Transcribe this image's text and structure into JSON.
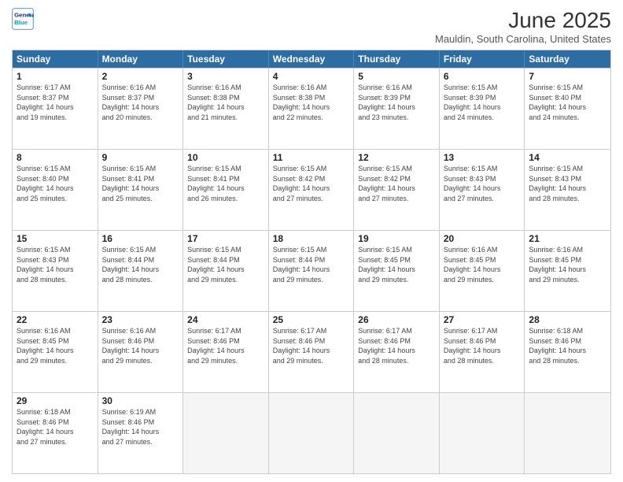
{
  "header": {
    "logo_line1": "General",
    "logo_line2": "Blue",
    "month_title": "June 2025",
    "location": "Mauldin, South Carolina, United States"
  },
  "days_of_week": [
    "Sunday",
    "Monday",
    "Tuesday",
    "Wednesday",
    "Thursday",
    "Friday",
    "Saturday"
  ],
  "weeks": [
    [
      {
        "num": "1",
        "sunrise": "6:17 AM",
        "sunset": "8:37 PM",
        "daylight": "14 hours and 19 minutes"
      },
      {
        "num": "2",
        "sunrise": "6:16 AM",
        "sunset": "8:37 PM",
        "daylight": "14 hours and 20 minutes"
      },
      {
        "num": "3",
        "sunrise": "6:16 AM",
        "sunset": "8:38 PM",
        "daylight": "14 hours and 21 minutes"
      },
      {
        "num": "4",
        "sunrise": "6:16 AM",
        "sunset": "8:38 PM",
        "daylight": "14 hours and 22 minutes"
      },
      {
        "num": "5",
        "sunrise": "6:16 AM",
        "sunset": "8:39 PM",
        "daylight": "14 hours and 23 minutes"
      },
      {
        "num": "6",
        "sunrise": "6:15 AM",
        "sunset": "8:39 PM",
        "daylight": "14 hours and 24 minutes"
      },
      {
        "num": "7",
        "sunrise": "6:15 AM",
        "sunset": "8:40 PM",
        "daylight": "14 hours and 24 minutes"
      }
    ],
    [
      {
        "num": "8",
        "sunrise": "6:15 AM",
        "sunset": "8:40 PM",
        "daylight": "14 hours and 25 minutes"
      },
      {
        "num": "9",
        "sunrise": "6:15 AM",
        "sunset": "8:41 PM",
        "daylight": "14 hours and 25 minutes"
      },
      {
        "num": "10",
        "sunrise": "6:15 AM",
        "sunset": "8:41 PM",
        "daylight": "14 hours and 26 minutes"
      },
      {
        "num": "11",
        "sunrise": "6:15 AM",
        "sunset": "8:42 PM",
        "daylight": "14 hours and 27 minutes"
      },
      {
        "num": "12",
        "sunrise": "6:15 AM",
        "sunset": "8:42 PM",
        "daylight": "14 hours and 27 minutes"
      },
      {
        "num": "13",
        "sunrise": "6:15 AM",
        "sunset": "8:43 PM",
        "daylight": "14 hours and 27 minutes"
      },
      {
        "num": "14",
        "sunrise": "6:15 AM",
        "sunset": "8:43 PM",
        "daylight": "14 hours and 28 minutes"
      }
    ],
    [
      {
        "num": "15",
        "sunrise": "6:15 AM",
        "sunset": "8:43 PM",
        "daylight": "14 hours and 28 minutes"
      },
      {
        "num": "16",
        "sunrise": "6:15 AM",
        "sunset": "8:44 PM",
        "daylight": "14 hours and 28 minutes"
      },
      {
        "num": "17",
        "sunrise": "6:15 AM",
        "sunset": "8:44 PM",
        "daylight": "14 hours and 29 minutes"
      },
      {
        "num": "18",
        "sunrise": "6:15 AM",
        "sunset": "8:44 PM",
        "daylight": "14 hours and 29 minutes"
      },
      {
        "num": "19",
        "sunrise": "6:15 AM",
        "sunset": "8:45 PM",
        "daylight": "14 hours and 29 minutes"
      },
      {
        "num": "20",
        "sunrise": "6:16 AM",
        "sunset": "8:45 PM",
        "daylight": "14 hours and 29 minutes"
      },
      {
        "num": "21",
        "sunrise": "6:16 AM",
        "sunset": "8:45 PM",
        "daylight": "14 hours and 29 minutes"
      }
    ],
    [
      {
        "num": "22",
        "sunrise": "6:16 AM",
        "sunset": "8:45 PM",
        "daylight": "14 hours and 29 minutes"
      },
      {
        "num": "23",
        "sunrise": "6:16 AM",
        "sunset": "8:46 PM",
        "daylight": "14 hours and 29 minutes"
      },
      {
        "num": "24",
        "sunrise": "6:17 AM",
        "sunset": "8:46 PM",
        "daylight": "14 hours and 29 minutes"
      },
      {
        "num": "25",
        "sunrise": "6:17 AM",
        "sunset": "8:46 PM",
        "daylight": "14 hours and 29 minutes"
      },
      {
        "num": "26",
        "sunrise": "6:17 AM",
        "sunset": "8:46 PM",
        "daylight": "14 hours and 28 minutes"
      },
      {
        "num": "27",
        "sunrise": "6:17 AM",
        "sunset": "8:46 PM",
        "daylight": "14 hours and 28 minutes"
      },
      {
        "num": "28",
        "sunrise": "6:18 AM",
        "sunset": "8:46 PM",
        "daylight": "14 hours and 28 minutes"
      }
    ],
    [
      {
        "num": "29",
        "sunrise": "6:18 AM",
        "sunset": "8:46 PM",
        "daylight": "14 hours and 27 minutes"
      },
      {
        "num": "30",
        "sunrise": "6:19 AM",
        "sunset": "8:46 PM",
        "daylight": "14 hours and 27 minutes"
      },
      null,
      null,
      null,
      null,
      null
    ]
  ]
}
